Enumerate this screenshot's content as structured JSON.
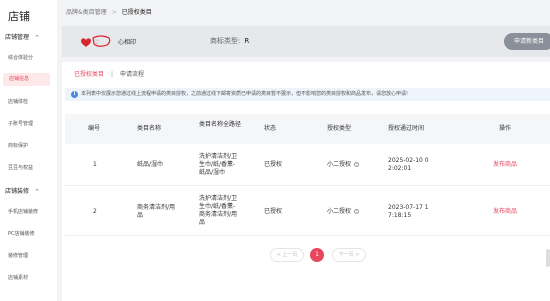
{
  "sidebar": {
    "title": "店铺",
    "groups": [
      {
        "label": "店铺管理",
        "chevron": "^"
      },
      {
        "label": "店铺装修",
        "chevron": "^"
      }
    ],
    "items": [
      {
        "label": "综合体验分"
      },
      {
        "label": "店铺信息"
      },
      {
        "label": "店铺体检"
      },
      {
        "label": "子账号管理"
      },
      {
        "label": "商标保护"
      },
      {
        "label": "豆豆与权益"
      },
      {
        "label": "手机店铺装修"
      },
      {
        "label": "PC店铺装修"
      },
      {
        "label": "装修管理"
      },
      {
        "label": "店铺素材"
      }
    ]
  },
  "breadcrumb": {
    "parent": "品牌&类目管理",
    "sep": ">",
    "current": "已授权类目"
  },
  "brand": {
    "name": "心相印",
    "reg_label": "商标类型:",
    "reg_value": "R",
    "apply_button": "申请新类目",
    "logo_color": "#d9262e"
  },
  "tabs": {
    "active": "已授权类目",
    "sep": "|",
    "other": "申请流程"
  },
  "notice": {
    "icon": "i",
    "text": "本列表中仅展示您通过线上流程申请的类目授权，之前通过线下邮寄资质已申请的类目暂不展示，但不影响您的类目授权和商品发布，请您放心申请!"
  },
  "table": {
    "headers": [
      "编号",
      "类目名称",
      "类目名称全路径",
      "状态",
      "授权类型",
      "授权通过时间",
      "操作"
    ],
    "rows": [
      {
        "no": "1",
        "name": "纸品/湿巾",
        "path": [
          "洗护清洁剂/卫",
          "生巾/纸/香薰-",
          "纸品/湿巾"
        ],
        "status": "已授权",
        "auth_type": "小二授权",
        "time": [
          "2025-02-10 0",
          "2:02:01"
        ],
        "action": "发布商品"
      },
      {
        "no": "2",
        "name": [
          "商务清洁剂/用",
          "品"
        ],
        "path": [
          "洗护清洁剂/卫",
          "生巾/纸/香薰-",
          "商务清洁剂/用",
          "品"
        ],
        "status": "已授权",
        "auth_type": "小二授权",
        "time": [
          "2023-07-17 1",
          "7:18:15"
        ],
        "action": "发布商品"
      }
    ]
  },
  "pager": {
    "prev": "< 上一页",
    "current": "1",
    "next": "下一页 >"
  },
  "accent": "#e8485e"
}
